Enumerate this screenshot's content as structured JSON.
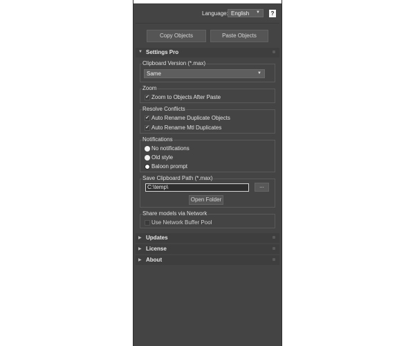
{
  "header": {
    "language_label": "Language:",
    "language_value": "English",
    "help_label": "?"
  },
  "actions": {
    "copy_label": "Copy Objects",
    "paste_label": "Paste Objects"
  },
  "settings": {
    "title": "Settings Pro",
    "expanded": true,
    "clipboard_version": {
      "title": "Clipboard Version (*.max)",
      "value": "Same"
    },
    "zoom": {
      "title": "Zoom",
      "options": [
        {
          "label": "Zoom to Objects After Paste",
          "checked": true
        }
      ]
    },
    "resolve": {
      "title": "Resolve Conflicts",
      "options": [
        {
          "label": "Auto Rename Duplicate Objects",
          "checked": true
        },
        {
          "label": "Auto Rename Mtl Duplicates",
          "checked": true
        }
      ]
    },
    "notifications": {
      "title": "Notifications",
      "options": [
        {
          "label": "No notifications",
          "selected": false
        },
        {
          "label": "Old style",
          "selected": false
        },
        {
          "label": "Baloon prompt",
          "selected": true
        }
      ]
    },
    "save_path": {
      "title": "Save Clipboard Path (*.max)",
      "value": "C:\\temp\\",
      "browse_label": "...",
      "open_folder_label": "Open Folder"
    },
    "network": {
      "title": "Share models via Network",
      "options": [
        {
          "label": "Use Network Buffer Pool",
          "checked": false,
          "enabled": false
        }
      ]
    }
  },
  "rollouts": [
    {
      "title": "Updates",
      "expanded": false
    },
    {
      "title": "License",
      "expanded": false
    },
    {
      "title": "About",
      "expanded": false
    }
  ],
  "icons": {
    "expanded": "triangle-down-icon",
    "collapsed": "triangle-right-icon",
    "dropdown": "chevron-down-icon",
    "check": "checkmark-icon"
  },
  "colors": {
    "panel_bg": "#444444",
    "rollout_header_bg": "#3e3e3e",
    "button_bg": "#555555",
    "text": "#dcdcdc"
  }
}
